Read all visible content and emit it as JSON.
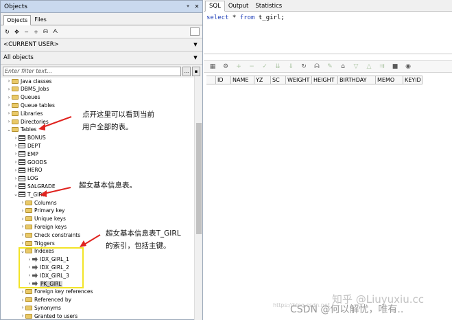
{
  "left_panel": {
    "title": "Objects",
    "tabs": [
      "Objects",
      "Files"
    ],
    "toolbar_icons": [
      "refresh-icon",
      "filter-icon",
      "minus-icon",
      "plus-icon",
      "binoculars-icon",
      "find-icon"
    ],
    "user_filter": "<CURRENT USER>",
    "object_filter": "All objects",
    "filter_placeholder": "Enter filter text...",
    "filter_button": "...",
    "tree": [
      {
        "label": "Java classes",
        "icon": "folder",
        "expanded": false,
        "level": 0
      },
      {
        "label": "DBMS_Jobs",
        "icon": "folder",
        "expanded": false,
        "level": 0
      },
      {
        "label": "Queues",
        "icon": "folder",
        "expanded": false,
        "level": 0
      },
      {
        "label": "Queue tables",
        "icon": "folder",
        "expanded": false,
        "level": 0
      },
      {
        "label": "Libraries",
        "icon": "folder",
        "expanded": false,
        "level": 0
      },
      {
        "label": "Directories",
        "icon": "folder",
        "expanded": false,
        "level": 0
      },
      {
        "label": "Tables",
        "icon": "folder",
        "expanded": true,
        "level": 0
      },
      {
        "label": "BONUS",
        "icon": "table",
        "expanded": false,
        "level": 1
      },
      {
        "label": "DEPT",
        "icon": "table",
        "expanded": false,
        "level": 1
      },
      {
        "label": "EMP",
        "icon": "table",
        "expanded": false,
        "level": 1
      },
      {
        "label": "GOODS",
        "icon": "table",
        "expanded": false,
        "level": 1
      },
      {
        "label": "HERO",
        "icon": "table",
        "expanded": false,
        "level": 1
      },
      {
        "label": "LOG",
        "icon": "table",
        "expanded": false,
        "level": 1
      },
      {
        "label": "SALGRADE",
        "icon": "table",
        "expanded": false,
        "level": 1
      },
      {
        "label": "T_GIRL",
        "icon": "table",
        "expanded": true,
        "level": 1
      },
      {
        "label": "Columns",
        "icon": "folder",
        "expanded": false,
        "level": 2
      },
      {
        "label": "Primary key",
        "icon": "folder",
        "expanded": false,
        "level": 2
      },
      {
        "label": "Unique keys",
        "icon": "folder",
        "expanded": false,
        "level": 2
      },
      {
        "label": "Foreign keys",
        "icon": "folder",
        "expanded": false,
        "level": 2
      },
      {
        "label": "Check constraints",
        "icon": "folder",
        "expanded": false,
        "level": 2
      },
      {
        "label": "Triggers",
        "icon": "folder",
        "expanded": false,
        "level": 2
      },
      {
        "label": "Indexes",
        "icon": "folder",
        "expanded": true,
        "level": 2
      },
      {
        "label": "IDX_GIRL_1",
        "icon": "index",
        "expanded": false,
        "level": 3
      },
      {
        "label": "IDX_GIRL_2",
        "icon": "index",
        "expanded": false,
        "level": 3
      },
      {
        "label": "IDX_GIRL_3",
        "icon": "index",
        "expanded": false,
        "level": 3
      },
      {
        "label": "PK_GIRL",
        "icon": "index",
        "expanded": false,
        "level": 3,
        "selected": true
      },
      {
        "label": "Foreign key references",
        "icon": "folder",
        "expanded": false,
        "level": 2
      },
      {
        "label": "Referenced by",
        "icon": "folder",
        "expanded": false,
        "level": 2
      },
      {
        "label": "Synonyms",
        "icon": "folder",
        "expanded": false,
        "level": 2
      },
      {
        "label": "Granted to users",
        "icon": "folder",
        "expanded": false,
        "level": 2
      }
    ]
  },
  "annotations": {
    "tables_note_line1": "点开这里可以看到当前",
    "tables_note_line2": "用户全部的表。",
    "tgirl_note": "超女基本信息表。",
    "indexes_note_line1": "超女基本信息表T_GIRL",
    "indexes_note_line2": "的索引，包括主键。",
    "arrow_color": "#e0231f",
    "highlight_color": "#f2e427"
  },
  "right_panel": {
    "tabs": [
      "SQL",
      "Output",
      "Statistics"
    ],
    "sql": {
      "kw1": "select",
      "rest1": " * ",
      "kw2": "from",
      "rest2": " t_girl;"
    },
    "grid_columns": [
      "ID",
      "NAME",
      "YZ",
      "SC",
      "WEIGHT",
      "HEIGHT",
      "BIRTHDAY",
      "MEMO",
      "KEYID"
    ]
  },
  "watermarks": {
    "csdn": "CSDN @何以解忧，唯有..",
    "zhihu": "知乎 @Liuyuxiu.cc",
    "faint": "https://blog.csdn.net"
  }
}
